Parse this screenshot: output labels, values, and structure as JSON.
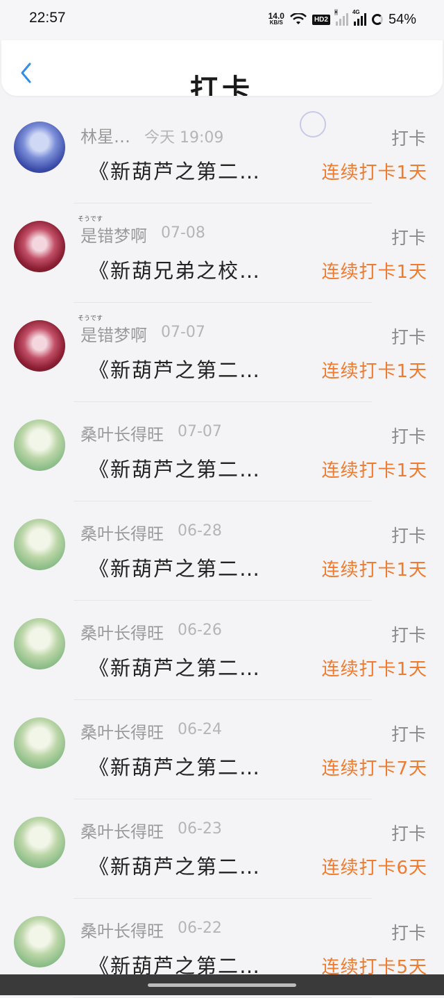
{
  "status": {
    "time": "22:57",
    "net_speed": "14.0",
    "net_unit": "KB/S",
    "hd_label": "HD2",
    "net_type": "4G",
    "battery": "54%"
  },
  "header": {
    "back_icon": "chevron-left-icon",
    "title": "打卡"
  },
  "items": [
    {
      "name": "林星…",
      "date": "今天 19:09",
      "kind": "打卡",
      "book": "《新葫芦之第二…",
      "streak": "连续打卡1天",
      "avatar": "blue",
      "ruby": ""
    },
    {
      "name": "是错梦啊",
      "date": "07-08",
      "kind": "打卡",
      "book": "《新葫兄弟之校…",
      "streak": "连续打卡1天",
      "avatar": "red",
      "ruby": "そうです"
    },
    {
      "name": "是错梦啊",
      "date": "07-07",
      "kind": "打卡",
      "book": "《新葫芦之第二…",
      "streak": "连续打卡1天",
      "avatar": "red",
      "ruby": "そうです"
    },
    {
      "name": "桑叶长得旺",
      "date": "07-07",
      "kind": "打卡",
      "book": "《新葫芦之第二…",
      "streak": "连续打卡1天",
      "avatar": "green",
      "ruby": ""
    },
    {
      "name": "桑叶长得旺",
      "date": "06-28",
      "kind": "打卡",
      "book": "《新葫芦之第二…",
      "streak": "连续打卡1天",
      "avatar": "green",
      "ruby": ""
    },
    {
      "name": "桑叶长得旺",
      "date": "06-26",
      "kind": "打卡",
      "book": "《新葫芦之第二…",
      "streak": "连续打卡1天",
      "avatar": "green",
      "ruby": ""
    },
    {
      "name": "桑叶长得旺",
      "date": "06-24",
      "kind": "打卡",
      "book": "《新葫芦之第二…",
      "streak": "连续打卡7天",
      "avatar": "green",
      "ruby": ""
    },
    {
      "name": "桑叶长得旺",
      "date": "06-23",
      "kind": "打卡",
      "book": "《新葫芦之第二…",
      "streak": "连续打卡6天",
      "avatar": "green",
      "ruby": ""
    },
    {
      "name": "桑叶长得旺",
      "date": "06-22",
      "kind": "打卡",
      "book": "《新葫芦之第二…",
      "streak": "连续打卡5天",
      "avatar": "green",
      "ruby": ""
    }
  ],
  "colors": {
    "accent": "#f07b2e",
    "back_icon": "#2e8fe6"
  }
}
